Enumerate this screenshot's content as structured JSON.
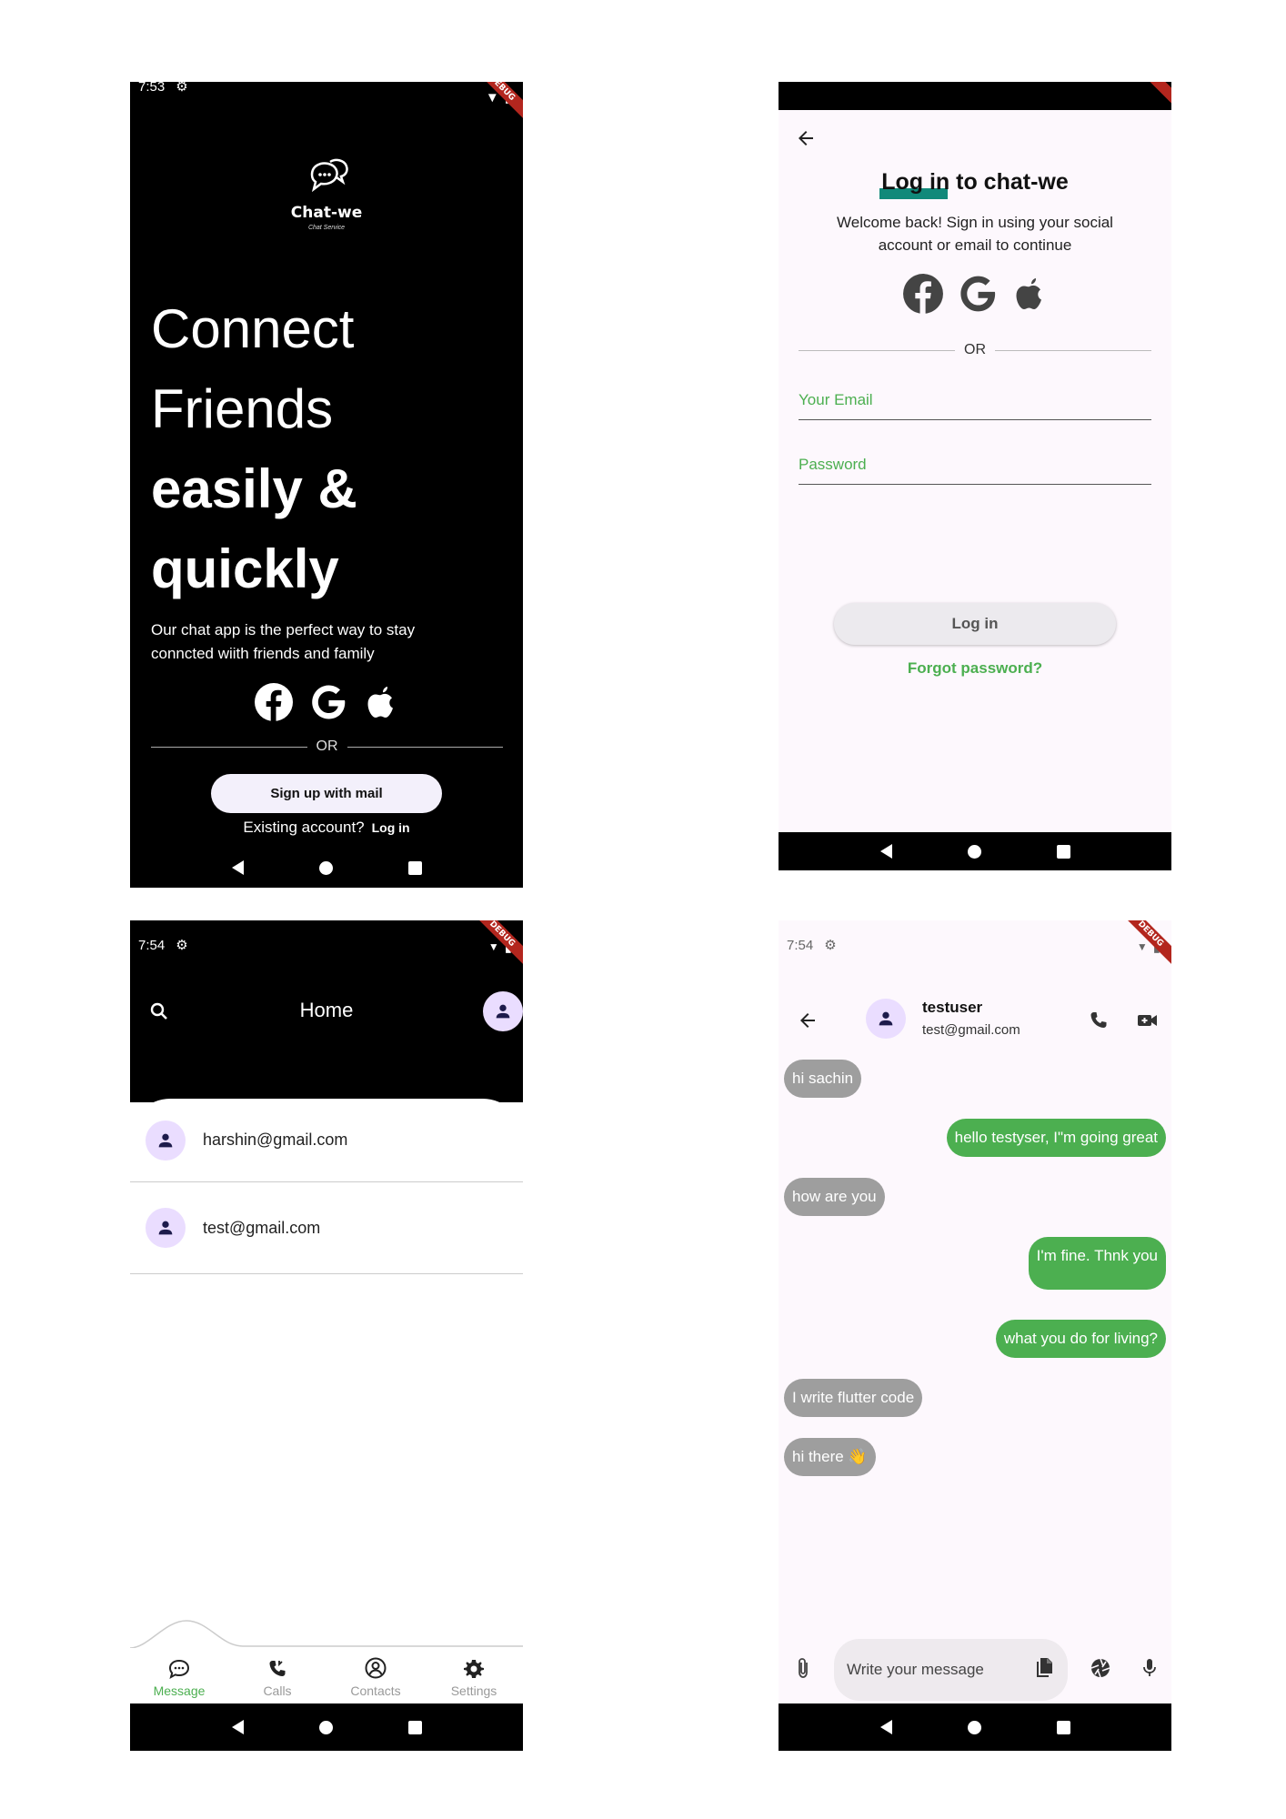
{
  "welcome_screen": {
    "status_time": "7:53",
    "debug_banner": "DEBUG",
    "brand": "Chat-we",
    "brand_sub": "Chat Service",
    "hero_line1": "Connect",
    "hero_line2": "Friends",
    "hero_line3": "easily &",
    "hero_line4": "quickly",
    "tagline": "Our chat app is the perfect way to stay conncted wiith friends and family",
    "divider": "OR",
    "signup_button": "Sign up with mail",
    "existing_text": "Existing account?",
    "login_link": "Log in",
    "social_icons": [
      "facebook-icon",
      "google-icon",
      "apple-icon"
    ]
  },
  "login_screen": {
    "title": "Log in to chat-we",
    "welcome": "Welcome back! Sign in using your social account or email to continue",
    "divider": "OR",
    "email_label": "Your Email",
    "password_label": "Password",
    "login_button": "Log in",
    "forgot_link": "Forgot password?",
    "accent_color": "#4caf50",
    "title_underline_color": "#11897a"
  },
  "home_screen": {
    "status_time": "7:54",
    "debug_banner": "DEBUG",
    "title": "Home",
    "contacts": [
      {
        "email": "harshin@gmail.com"
      },
      {
        "email": "test@gmail.com"
      }
    ],
    "tabs": [
      {
        "label": "Message",
        "icon": "message-icon",
        "active": true
      },
      {
        "label": "Calls",
        "icon": "calls-icon",
        "active": false
      },
      {
        "label": "Contacts",
        "icon": "contacts-icon",
        "active": false
      },
      {
        "label": "Settings",
        "icon": "settings-icon",
        "active": false
      }
    ]
  },
  "chat_screen": {
    "status_time": "7:54",
    "debug_banner": "DEBUG",
    "username": "testuser",
    "user_email": "test@gmail.com",
    "messages": [
      {
        "text": "hi sachin",
        "dir": "in"
      },
      {
        "text": "hello testyser, I\"m going great",
        "dir": "out"
      },
      {
        "text": "how are you",
        "dir": "in"
      },
      {
        "text": "I'm fine. Thnk you",
        "dir": "out"
      },
      {
        "text": "what you do for living?",
        "dir": "out"
      },
      {
        "text": "I write flutter code",
        "dir": "in"
      },
      {
        "text": "hi there 👋",
        "dir": "in"
      }
    ],
    "input_placeholder": "Write your message",
    "incoming_color": "#9e9e9e",
    "outgoing_color": "#4caf50"
  }
}
